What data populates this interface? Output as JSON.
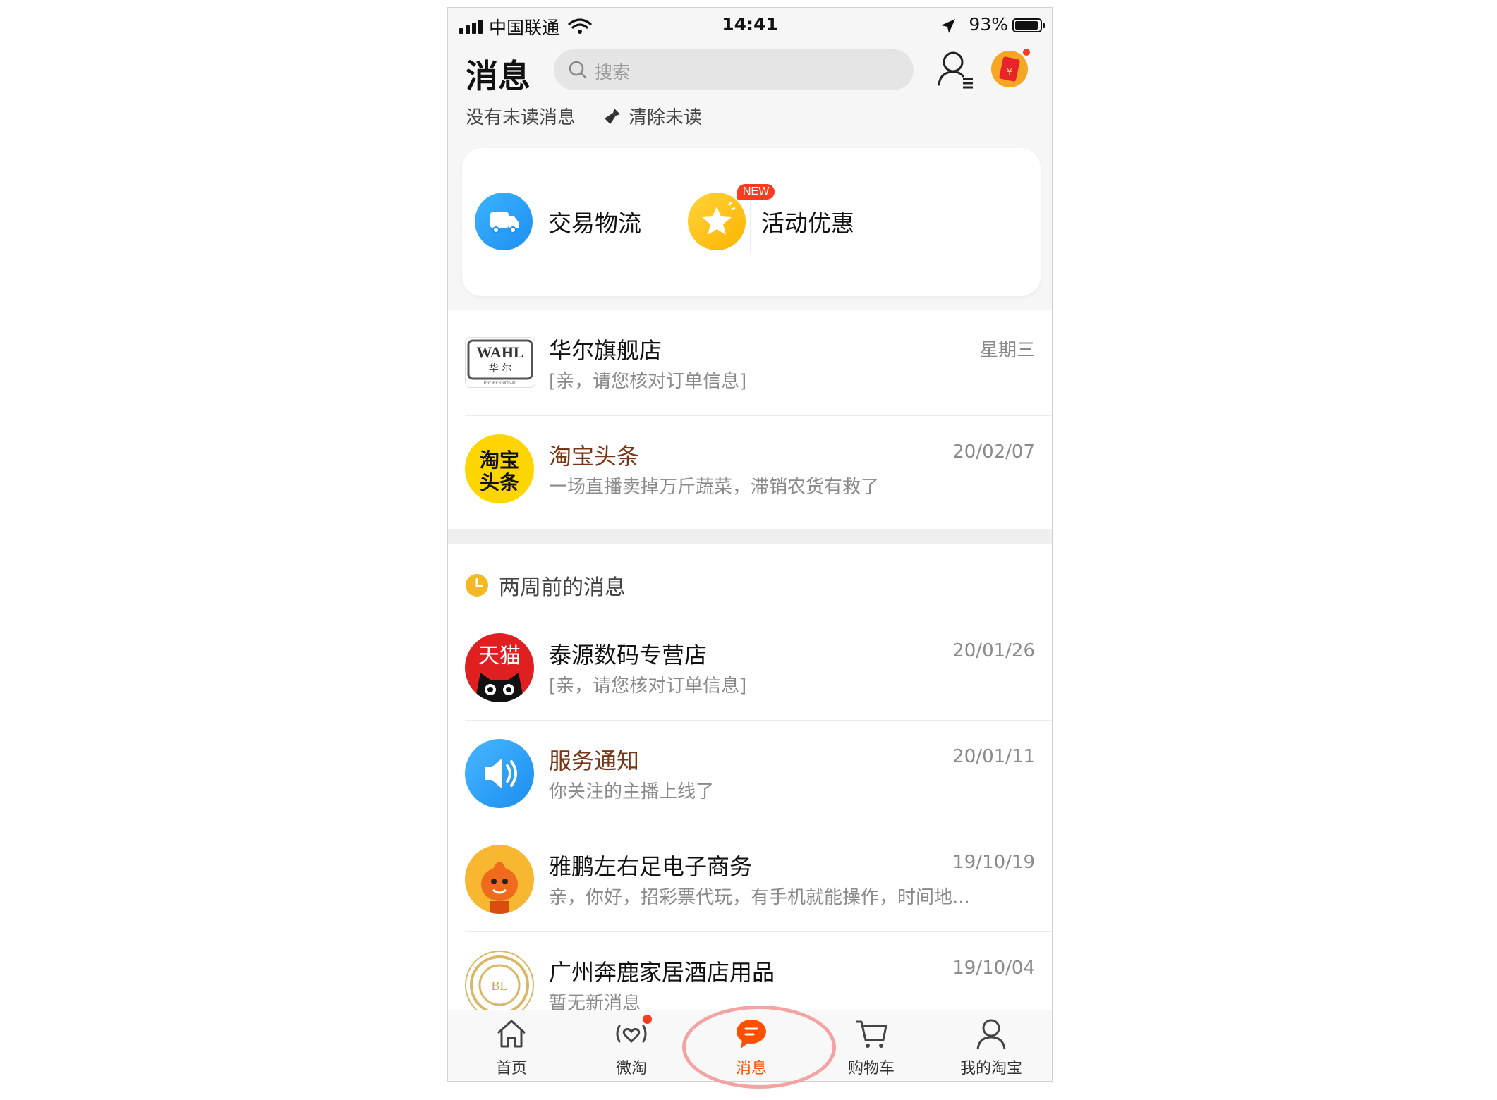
{
  "status_bar": {
    "carrier": "中国联通",
    "time": "14:41",
    "battery": "93%",
    "battery_level": 0.93
  },
  "header": {
    "title": "消息",
    "search_placeholder": "搜索"
  },
  "subheader": {
    "unread_status": "没有未读消息",
    "clear_label": "清除未读"
  },
  "quick_entries": [
    {
      "label": "交易物流",
      "color": "#1e9bf0"
    },
    {
      "label": "活动优惠",
      "color": "#ffc21a",
      "badge": "NEW"
    }
  ],
  "recent_messages": [
    {
      "name": "华尔旗舰店",
      "preview": "[亲，请您核对订单信息]",
      "date": "星期三",
      "avatar_text": "WAHL",
      "avatar_sub": "华 尔",
      "avatar_small": "PROFESSIONAL"
    },
    {
      "name": "淘宝头条",
      "preview": "一场直播卖掉万斤蔬菜，滞销农货有救了",
      "date": "20/02/07",
      "avatar_text": "淘宝头条"
    }
  ],
  "older_section": {
    "title": "两周前的消息",
    "messages": [
      {
        "name": "泰源数码专营店",
        "preview": "[亲，请您核对订单信息]",
        "date": "20/01/26",
        "avatar_text": "天猫"
      },
      {
        "name": "服务通知",
        "preview": "你关注的主播上线了",
        "date": "20/01/11"
      },
      {
        "name": "雅鹏左右足电子商务",
        "preview": "亲，你好，招彩票代玩，有手机就能操作，时间地...",
        "date": "19/10/19"
      },
      {
        "name": "广州奔鹿家居酒店用品",
        "preview": "暂无新消息",
        "date": "19/10/04",
        "avatar_text": "BL"
      }
    ]
  },
  "tab_bar": {
    "tabs": [
      {
        "label": "首页",
        "icon": "home-icon"
      },
      {
        "label": "微淘",
        "icon": "broadcast-heart-icon"
      },
      {
        "label": "消息",
        "icon": "chat-bubble-icon",
        "active": true
      },
      {
        "label": "购物车",
        "icon": "cart-icon"
      },
      {
        "label": "我的淘宝",
        "icon": "profile-icon"
      }
    ]
  },
  "colors": {
    "accent": "#ff5000",
    "highlight_ring": "#f4a3a3",
    "brown_name": "#7a3514"
  }
}
